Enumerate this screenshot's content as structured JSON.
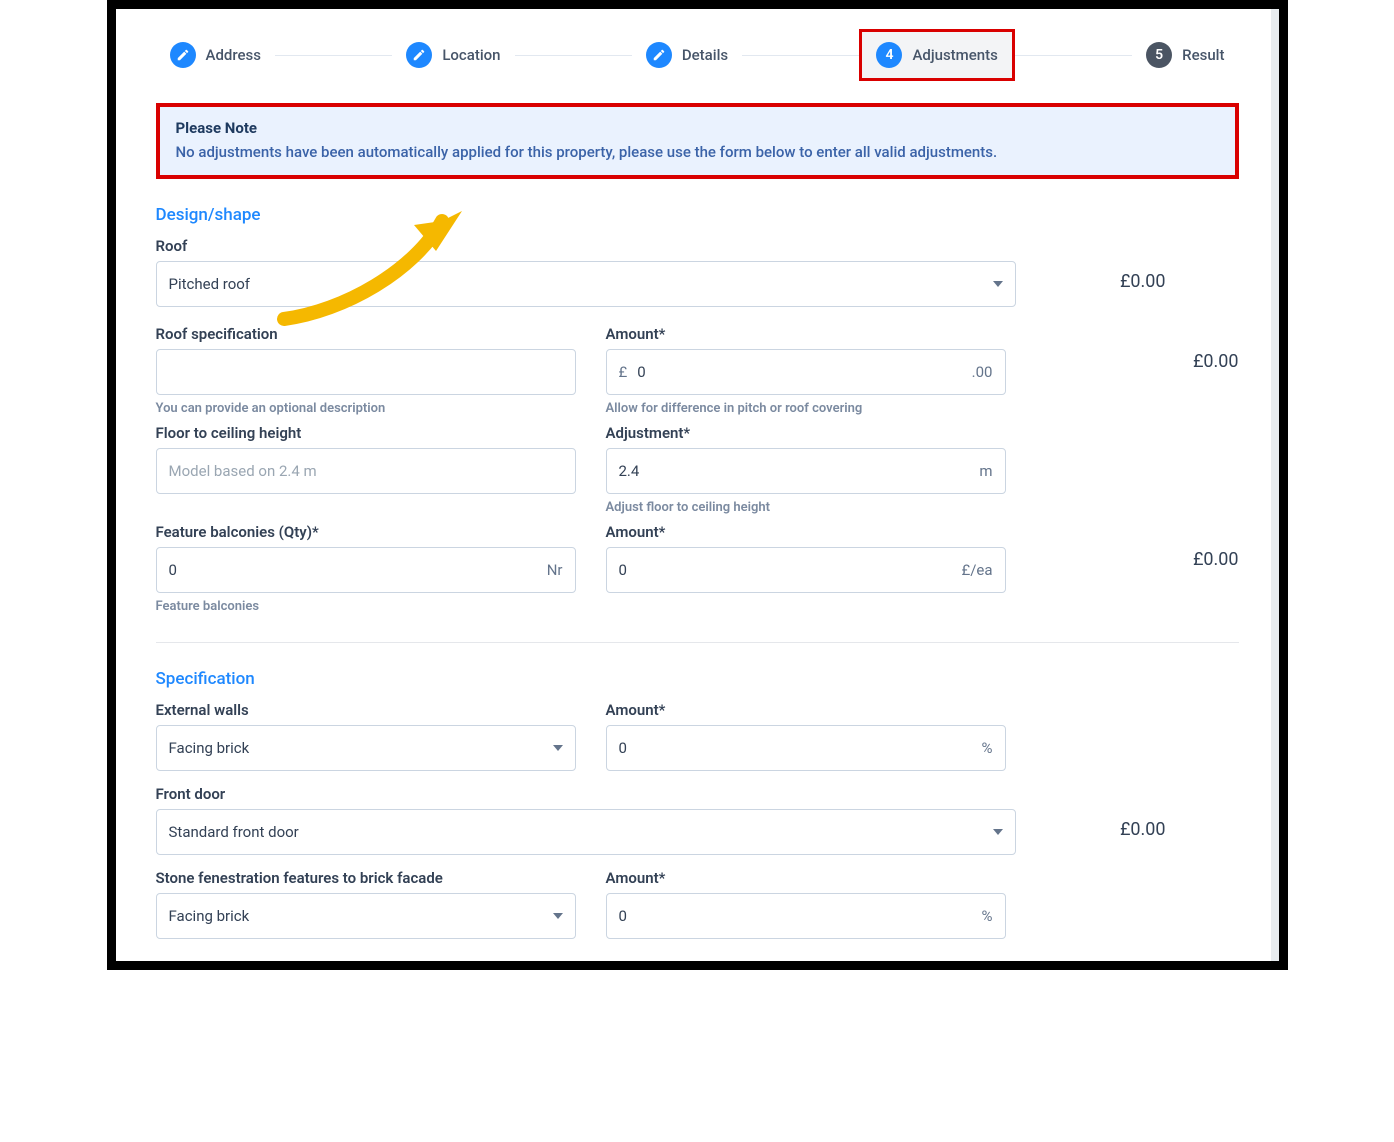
{
  "stepper": {
    "steps": [
      {
        "label": "Address",
        "state": "done"
      },
      {
        "label": "Location",
        "state": "done"
      },
      {
        "label": "Details",
        "state": "done"
      },
      {
        "label": "Adjustments",
        "num": "4",
        "state": "active"
      },
      {
        "label": "Result",
        "num": "5",
        "state": "pending"
      }
    ]
  },
  "notice": {
    "title": "Please Note",
    "message": "No adjustments have been automatically applied for this property, please use the form below to enter all valid adjustments."
  },
  "sections": {
    "design_shape": {
      "title": "Design/shape",
      "roof": {
        "label": "Roof",
        "value": "Pitched roof",
        "price": "£0.00"
      },
      "roof_spec": {
        "label": "Roof specification",
        "value": "",
        "helper": "You can provide an optional description",
        "amount_label": "Amount*",
        "amount_prefix": "£",
        "amount_value": "0",
        "amount_suffix": ".00",
        "amount_helper": "Allow for difference in pitch or roof covering",
        "price": "£0.00"
      },
      "floor_ceiling": {
        "label": "Floor to ceiling height",
        "placeholder": "Model based on 2.4 m",
        "adj_label": "Adjustment*",
        "adj_value": "2.4",
        "adj_suffix": "m",
        "adj_helper": "Adjust floor to ceiling height"
      },
      "balconies": {
        "label": "Feature balconies (Qty)*",
        "value": "0",
        "suffix": "Nr",
        "helper": "Feature balconies",
        "amount_label": "Amount*",
        "amount_value": "0",
        "amount_suffix": "£/ea",
        "price": "£0.00"
      }
    },
    "specification": {
      "title": "Specification",
      "external_walls": {
        "label": "External walls",
        "value": "Facing brick",
        "amount_label": "Amount*",
        "amount_value": "0",
        "amount_suffix": "%"
      },
      "front_door": {
        "label": "Front door",
        "value": "Standard front door",
        "price": "£0.00"
      },
      "stone_fenestration": {
        "label": "Stone fenestration features to brick facade",
        "value": "Facing brick",
        "amount_label": "Amount*",
        "amount_value": "0",
        "amount_suffix": "%"
      }
    }
  },
  "icons": {
    "pencil": "pencil-icon",
    "chevron": "chevron-down-icon"
  }
}
